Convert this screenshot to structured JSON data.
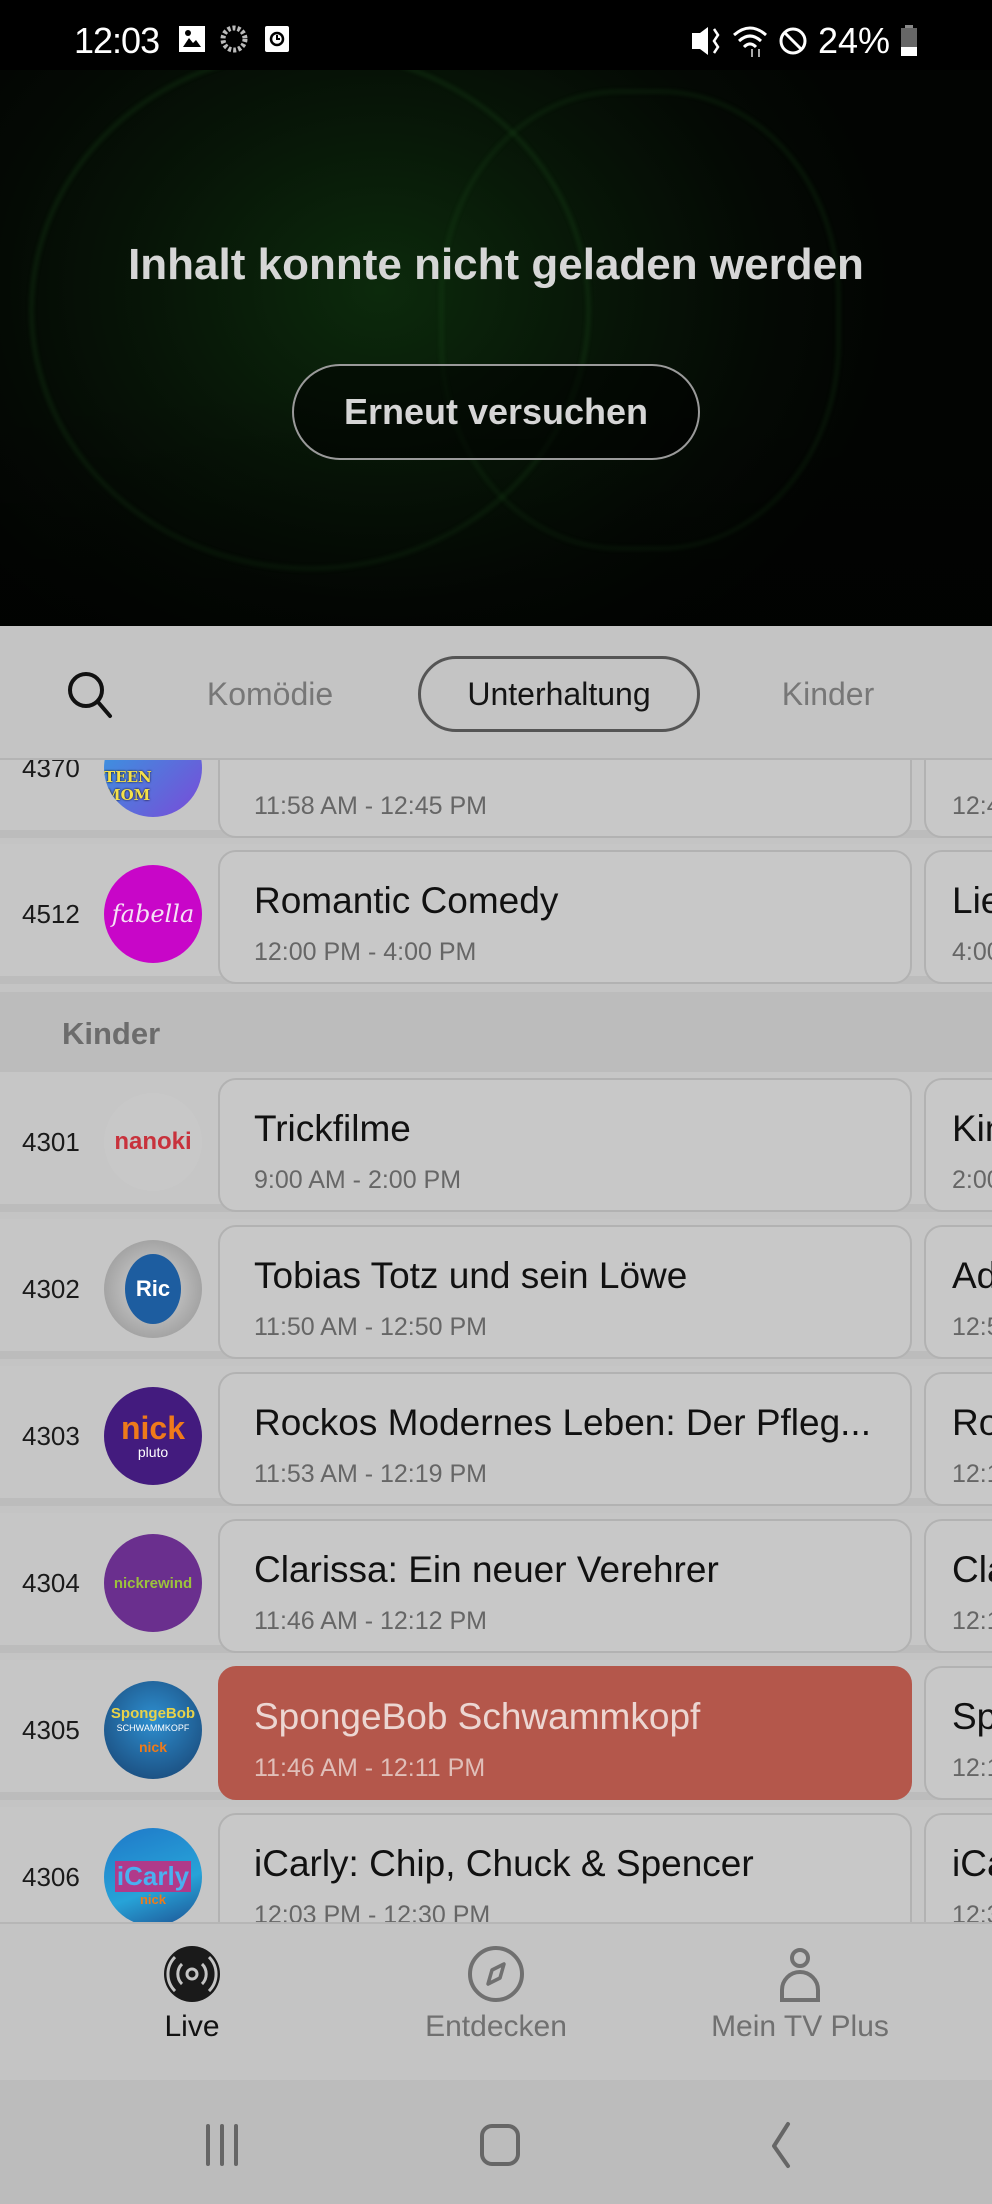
{
  "status_bar": {
    "time": "12:03",
    "left_icons": [
      "gallery-icon",
      "loading-ring-icon",
      "clock-app-icon"
    ],
    "right_icons": [
      "vibrate-mute-icon",
      "wifi-icon",
      "do-not-disturb-icon",
      "battery-icon"
    ],
    "battery": "24%"
  },
  "hero": {
    "error_message": "Inhalt konnte nicht geladen werden",
    "retry_label": "Erneut versuchen"
  },
  "category_tabs": {
    "search_icon": "search-icon",
    "tabs": [
      {
        "label": "Komödie",
        "active": false
      },
      {
        "label": "Unterhaltung",
        "active": true
      },
      {
        "label": "Kinder",
        "active": false
      }
    ]
  },
  "guide": {
    "rows_top": [
      {
        "number": "4370",
        "logo": "TEEN MOM",
        "title": "",
        "time": "11:58 AM - 12:45 PM",
        "next_title": "",
        "next_time": "12:4"
      },
      {
        "number": "4512",
        "logo": "fabella",
        "title": "Romantic Comedy",
        "time": "12:00 PM - 4:00 PM",
        "next_title": "Lie",
        "next_time": "4:00"
      }
    ],
    "section": "Kinder",
    "rows_kinder": [
      {
        "number": "4301",
        "logo": "nanoki",
        "title": "Trickfilme",
        "time": "9:00 AM - 2:00 PM",
        "next_title": "Kin",
        "next_time": "2:00"
      },
      {
        "number": "4302",
        "logo": "Ric",
        "title": "Tobias Totz und sein Löwe",
        "time": "11:50 AM - 12:50 PM",
        "next_title": "Ad",
        "next_time": "12:5"
      },
      {
        "number": "4303",
        "logo": "nick pluto",
        "title": "Rockos Modernes Leben: Der Pfleg...",
        "time": "11:53 AM - 12:19 PM",
        "next_title": "Ro",
        "next_time": "12:1"
      },
      {
        "number": "4304",
        "logo": "nickrewind",
        "title": "Clarissa: Ein neuer Verehrer",
        "time": "11:46 AM - 12:12 PM",
        "next_title": "Cla",
        "next_time": "12:1"
      },
      {
        "number": "4305",
        "logo": "SpongeBob",
        "title": "SpongeBob Schwammkopf",
        "time": "11:46 AM - 12:11 PM",
        "next_title": "Sp",
        "next_time": "12:1",
        "playing": true
      },
      {
        "number": "4306",
        "logo": "iCarly",
        "title": "iCarly: Chip, Chuck & Spencer",
        "time": "12:03 PM - 12:30 PM",
        "next_title": "iCa",
        "next_time": "12:3"
      }
    ]
  },
  "bottom_nav": [
    {
      "label": "Live",
      "icon": "live-broadcast-icon",
      "active": true
    },
    {
      "label": "Entdecken",
      "icon": "compass-icon",
      "active": false
    },
    {
      "label": "Mein TV Plus",
      "icon": "person-icon",
      "active": false
    }
  ],
  "system_nav": [
    "recents-icon",
    "home-icon",
    "back-icon"
  ],
  "colors": {
    "live_highlight": "#b4574b",
    "active_text": "#111111",
    "inactive_text": "#777777"
  }
}
